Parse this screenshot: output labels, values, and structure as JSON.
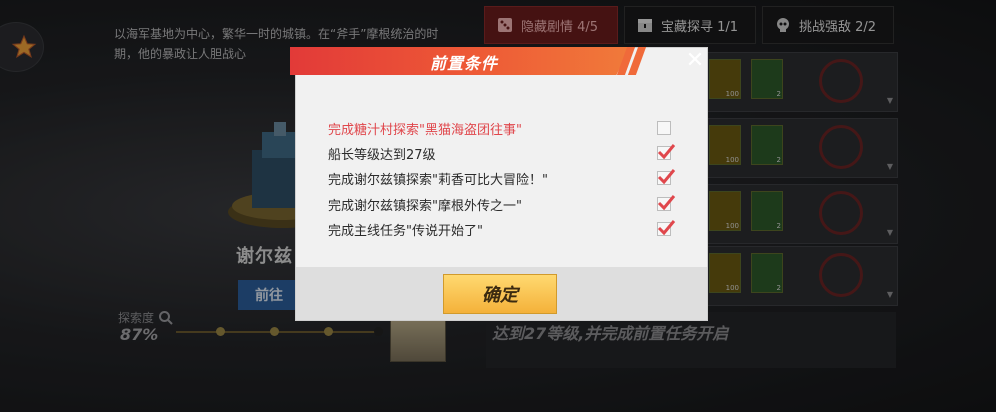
{
  "description": "以海军基地为中心，繁华一时的城镇。在“斧手”摩根统治的时期，他的暴政让人胆战心",
  "town": {
    "name": "谢尔兹",
    "goto_label": "前往"
  },
  "explore": {
    "label": "探索度",
    "value": "87%"
  },
  "tabs": [
    {
      "label": "隐藏剧情 4/5",
      "icon": "dice-icon"
    },
    {
      "label": "宝藏探寻 1/1",
      "icon": "treasure-icon"
    },
    {
      "label": "挑战强敌 2/2",
      "icon": "skull-icon"
    }
  ],
  "rows": [
    {
      "gold": "100",
      "green": "2"
    },
    {
      "gold": "100",
      "green": "2"
    },
    {
      "gold": "100",
      "green": "2"
    },
    {
      "gold": "100",
      "green": "2"
    }
  ],
  "bottom_message": "达到27等级,并完成前置任务开启",
  "modal": {
    "title": "前置条件",
    "conditions": [
      {
        "text": "完成糖汁村探索\"黑猫海盗团往事\"",
        "met": false
      },
      {
        "text": "船长等级达到27级",
        "met": true
      },
      {
        "text": "完成谢尔兹镇探索\"莉香可比大冒险！\"",
        "met": true
      },
      {
        "text": "完成谢尔兹镇探索\"摩根外传之一\"",
        "met": true
      },
      {
        "text": "完成主线任务\"传说开始了\"",
        "met": true
      }
    ],
    "confirm_label": "确定"
  },
  "colors": {
    "unmet": "#e0474c",
    "check": "#e0474c",
    "header": "#e23a38",
    "confirm": "#f4b13a"
  }
}
